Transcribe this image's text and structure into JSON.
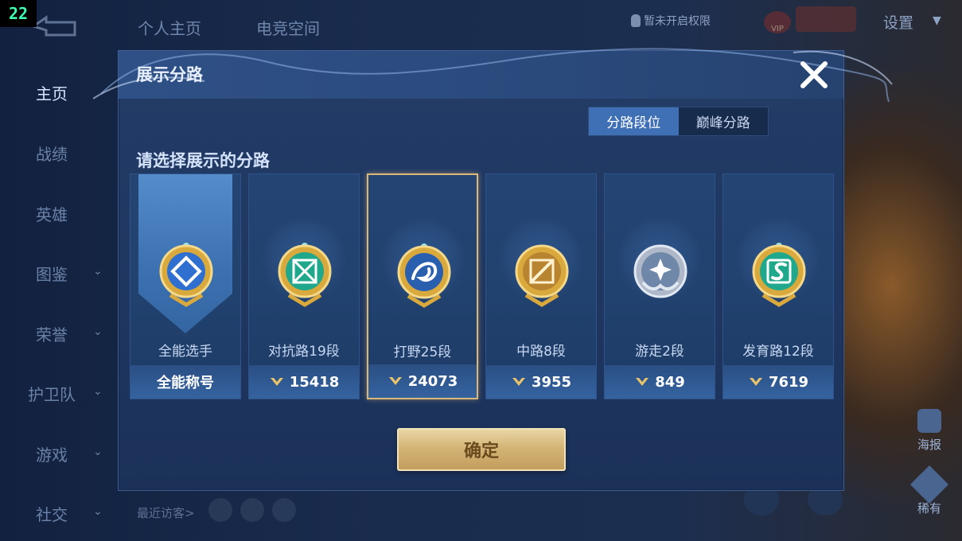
{
  "fps_counter": "22",
  "top_tabs": [
    "个人主页",
    "电竞空间"
  ],
  "permission_text": "暂未开启权限",
  "settings_label": "设置",
  "sidebar": [
    {
      "label": "主页",
      "active": true,
      "chevron": false
    },
    {
      "label": "战绩",
      "active": false,
      "chevron": false
    },
    {
      "label": "英雄",
      "active": false,
      "chevron": false
    },
    {
      "label": "图鉴",
      "active": false,
      "chevron": true
    },
    {
      "label": "荣誉",
      "active": false,
      "chevron": true
    },
    {
      "label": "护卫队",
      "active": false,
      "chevron": true
    },
    {
      "label": "游戏",
      "active": false,
      "chevron": true
    },
    {
      "label": "社交",
      "active": false,
      "chevron": true
    }
  ],
  "recent_visitors_label": "最近访客>",
  "right_panel": {
    "poster_label": "海报",
    "rare_label": "稀有"
  },
  "dialog": {
    "title": "展示分路",
    "toggle": {
      "option1": "分路段位",
      "option2": "巅峰分路"
    },
    "prompt": "请选择展示的分路",
    "cards": [
      {
        "name": "全能选手",
        "value": "全能称号",
        "icon": "all-round-emblem",
        "selected": false,
        "highlighted": true
      },
      {
        "name": "对抗路19段",
        "value": "15418",
        "icon": "clash-lane-emblem",
        "selected": false,
        "highlighted": false
      },
      {
        "name": "打野25段",
        "value": "24073",
        "icon": "jungle-emblem",
        "selected": true,
        "highlighted": false
      },
      {
        "name": "中路8段",
        "value": "3955",
        "icon": "mid-lane-emblem",
        "selected": false,
        "highlighted": false
      },
      {
        "name": "游走2段",
        "value": "849",
        "icon": "roam-emblem",
        "selected": false,
        "highlighted": false
      },
      {
        "name": "发育路12段",
        "value": "7619",
        "icon": "farm-lane-emblem",
        "selected": false,
        "highlighted": false
      }
    ],
    "confirm_label": "确定"
  },
  "colors": {
    "dialog_bg": "#1e3660",
    "toggle_active": "#3f6fb5",
    "confirm_gold": "#d4b577",
    "selected_border": "#d9b87a"
  }
}
